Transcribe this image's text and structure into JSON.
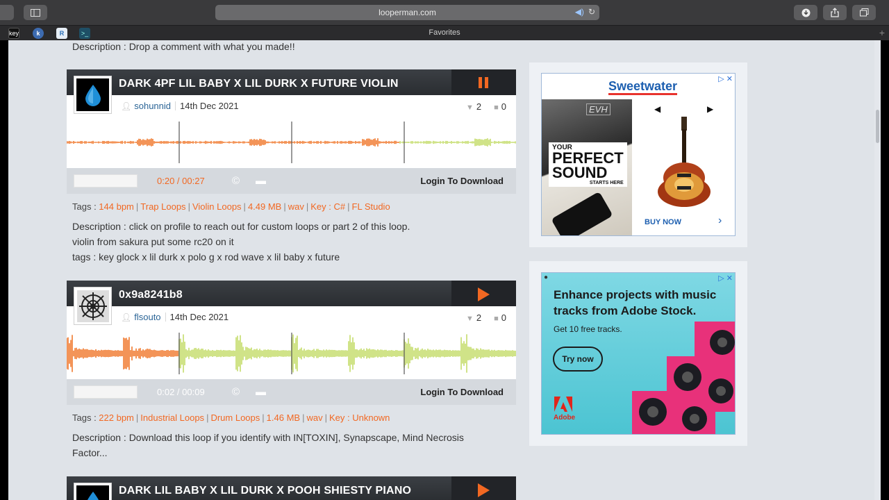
{
  "browser": {
    "url": "looperman.com",
    "favorites_label": "Favorites",
    "fav_items": [
      "key",
      "k",
      "R",
      ">_"
    ]
  },
  "top_description": "Description : Drop a comment with what you made!!",
  "loops": [
    {
      "title": "DARK 4PF LIL BABY X LIL DURK X FUTURE VIOLIN",
      "user": "sohunnid",
      "date": "14th Dec 2021",
      "votes": "2",
      "comments": "0",
      "time": "0:20 / 00:27",
      "login_label": "Login To Download",
      "state": "playing",
      "progress": 0.74,
      "tags_label": "Tags :",
      "tags": [
        "144 bpm",
        "Trap Loops",
        "Violin Loops",
        "4.49 MB",
        "wav",
        "Key : C#",
        "FL Studio"
      ],
      "description": [
        "Description : click on profile to reach out for custom loops or part 2 of this loop.",
        "violin from sakura put some rc20 on it",
        "tags : key glock x lil durk x polo g x rod wave x lil baby x future"
      ]
    },
    {
      "title": "0x9a8241b8",
      "user": "flsouto",
      "date": "14th Dec 2021",
      "votes": "2",
      "comments": "0",
      "time": "0:02 / 00:09",
      "login_label": "Login To Download",
      "state": "stopped",
      "progress": 0.25,
      "tags_label": "Tags :",
      "tags": [
        "222 bpm",
        "Industrial Loops",
        "Drum Loops",
        "1.46 MB",
        "wav",
        "Key : Unknown"
      ],
      "description": [
        "Description : Download this loop if you identify with IN[TOXIN], Synapscape, Mind Necrosis",
        "Factor..."
      ]
    },
    {
      "title": "DARK LIL BABY X LIL DURK X POOH SHIESTY PIANO"
    }
  ],
  "ads": {
    "sweetwater": {
      "brand": "Sweetwater",
      "headline_1": "YOUR",
      "headline_2": "PERFECT",
      "headline_3": "SOUND",
      "headline_4": "STARTS HERE",
      "cta": "BUY NOW",
      "amp_label": "EVH"
    },
    "adobe": {
      "headline": "Enhance projects with music tracks from Adobe Stock.",
      "sub": "Get 10 free tracks.",
      "cta": "Try now",
      "brand": "Adobe"
    }
  },
  "colors": {
    "accent": "#f26822",
    "played": "#f07a2e",
    "unplayed": "#c4dc6a",
    "link": "#2a6496"
  }
}
